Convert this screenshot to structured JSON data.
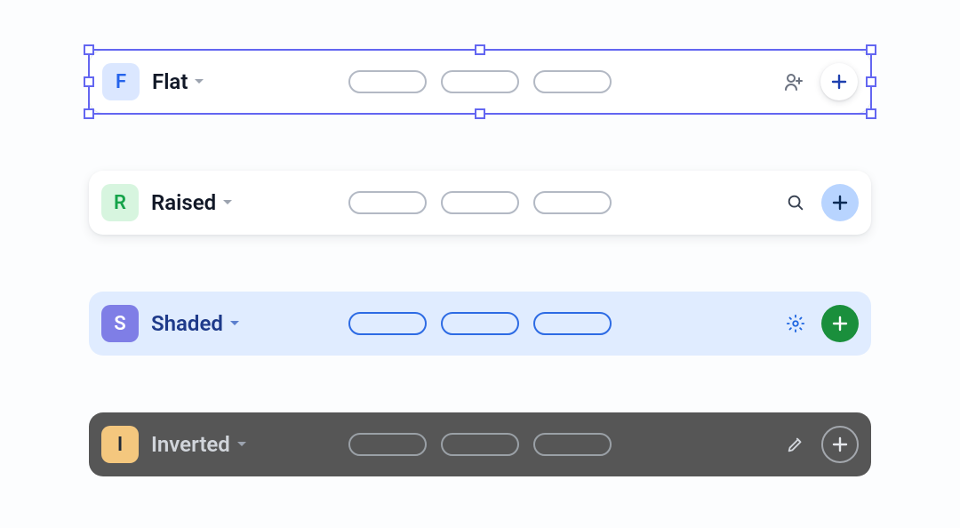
{
  "rows": [
    {
      "variant": "flat",
      "letter": "F",
      "label": "Flat",
      "selected": true,
      "action_icon": "add-user",
      "plus_style": "shadow",
      "plus_color": "#1e40af",
      "badge_style": "blue",
      "caret_color": "#9ca3af",
      "pill_style": "gray"
    },
    {
      "variant": "raised",
      "letter": "R",
      "label": "Raised",
      "selected": false,
      "action_icon": "search",
      "plus_style": "lightblue",
      "plus_color": "#0b2a55",
      "badge_style": "green",
      "caret_color": "#9ca3af",
      "pill_style": "gray"
    },
    {
      "variant": "shaded",
      "letter": "S",
      "label": "Shaded",
      "selected": false,
      "action_icon": "gear",
      "plus_style": "green",
      "plus_color": "#ffffff",
      "badge_style": "purple",
      "caret_color": "#5b7fce",
      "pill_style": "blue"
    },
    {
      "variant": "inverted",
      "letter": "I",
      "label": "Inverted",
      "selected": false,
      "action_icon": "pencil",
      "plus_style": "outline",
      "plus_color": "#e5e7eb",
      "badge_style": "orange",
      "caret_color": "#9ca3af",
      "pill_style": "dk"
    }
  ]
}
